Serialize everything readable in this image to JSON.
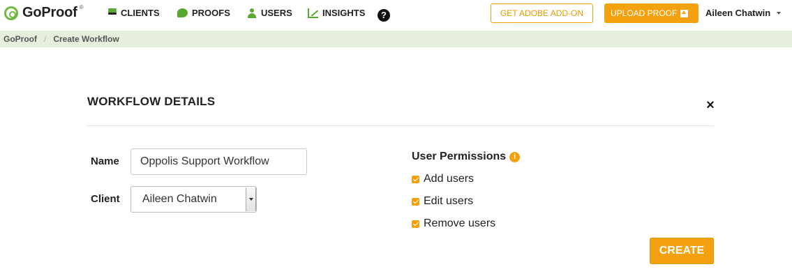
{
  "app": {
    "logo_text": "GoProof",
    "logo_tm": "®"
  },
  "nav": {
    "items": [
      {
        "label": "CLIENTS",
        "icon": "clients-icon"
      },
      {
        "label": "PROOFS",
        "icon": "proofs-icon"
      },
      {
        "label": "USERS",
        "icon": "users-icon"
      },
      {
        "label": "INSIGHTS",
        "icon": "insights-icon"
      }
    ],
    "help": "?",
    "adobe_button": "GET ADOBE ADD-ON",
    "upload_button": "UPLOAD PROOF",
    "user_name": "Aileen Chatwin"
  },
  "breadcrumb": {
    "root": "GoProof",
    "separator": "/",
    "current": "Create Workflow"
  },
  "workflow": {
    "title": "WORKFLOW DETAILS",
    "close": "×",
    "name_label": "Name",
    "name_value": "Oppolis Support Workflow",
    "client_label": "Client",
    "client_value": "Aileen Chatwin",
    "permissions_title": "User Permissions",
    "info": "i",
    "permissions": [
      {
        "label": "Add users",
        "checked": true
      },
      {
        "label": "Edit users",
        "checked": true
      },
      {
        "label": "Remove users",
        "checked": true
      }
    ],
    "create_button": "CREATE"
  },
  "colors": {
    "accent": "#f4a10f",
    "brand_green": "#5aa832",
    "breadcrumb_bg": "#e6efdd"
  }
}
